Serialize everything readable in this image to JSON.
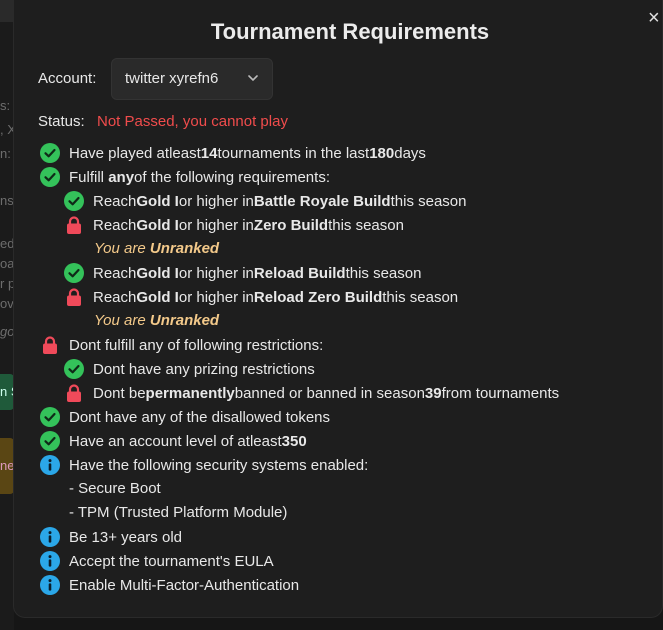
{
  "title": "Tournament Requirements",
  "close_icon": "×",
  "account": {
    "label": "Account:",
    "selected": "twitter xyrefn6"
  },
  "status": {
    "label": "Status:",
    "value": "Not Passed, you cannot play",
    "color": "#f04c4c"
  },
  "colors": {
    "pass": "#34c25a",
    "fail": "#f04a5a",
    "info": "#2ba7e8",
    "note": "#f3c98a"
  },
  "requirements": {
    "played": {
      "icon": "check-icon",
      "a": "Have played atleast ",
      "b": "14",
      "c": " tournaments in the last ",
      "d": "180",
      "e": " days"
    },
    "fulfill_any": {
      "icon": "check-icon",
      "a": "Fulfill ",
      "b": "any",
      "c": " of the following requirements:"
    },
    "sub": [
      {
        "icon": "check-icon",
        "a": "Reach ",
        "b": "Gold I",
        "c": " or higher in ",
        "d": "Battle Royale Build",
        "e": " this season"
      },
      {
        "icon": "lock-icon",
        "a": "Reach ",
        "b": "Gold I",
        "c": " or higher in ",
        "d": "Zero Build",
        "e": " this season",
        "note_a": "You are ",
        "note_b": "Unranked"
      },
      {
        "icon": "check-icon",
        "a": "Reach ",
        "b": "Gold I",
        "c": " or higher in ",
        "d": "Reload Build",
        "e": " this season"
      },
      {
        "icon": "lock-icon",
        "a": "Reach ",
        "b": "Gold I",
        "c": " or higher in ",
        "d": "Reload Zero Build",
        "e": " this season",
        "note_a": "You are ",
        "note_b": "Unranked"
      }
    ],
    "restrictions": {
      "icon": "lock-icon",
      "text": "Dont fulfill any of following restrictions:"
    },
    "restriction_items": [
      {
        "icon": "check-icon",
        "text": "Dont have any prizing restrictions"
      },
      {
        "icon": "lock-icon",
        "a": "Dont be ",
        "b": "permanently",
        "c": " banned or banned in season ",
        "d": "39",
        "e": " from tournaments"
      }
    ],
    "tokens": {
      "icon": "check-icon",
      "text": "Dont have any of the disallowed tokens"
    },
    "level": {
      "icon": "check-icon",
      "a": "Have an account level of atleast ",
      "b": "350"
    },
    "security": {
      "icon": "info-icon",
      "text": "Have the following security systems enabled:",
      "items": [
        "- Secure Boot",
        "- TPM (Trusted Platform Module)"
      ]
    },
    "age": {
      "icon": "info-icon",
      "text": "Be 13+ years old"
    },
    "eula": {
      "icon": "info-icon",
      "text": "Accept the tournament's EULA"
    },
    "mfa": {
      "icon": "info-icon",
      "text": "Enable Multi-Factor-Authentication"
    }
  },
  "background": {
    "fragments": [
      "s:",
      ", X",
      "n:",
      "ns",
      "ed",
      "oa",
      "r p",
      "ov",
      "go",
      "n S",
      "ne"
    ]
  }
}
